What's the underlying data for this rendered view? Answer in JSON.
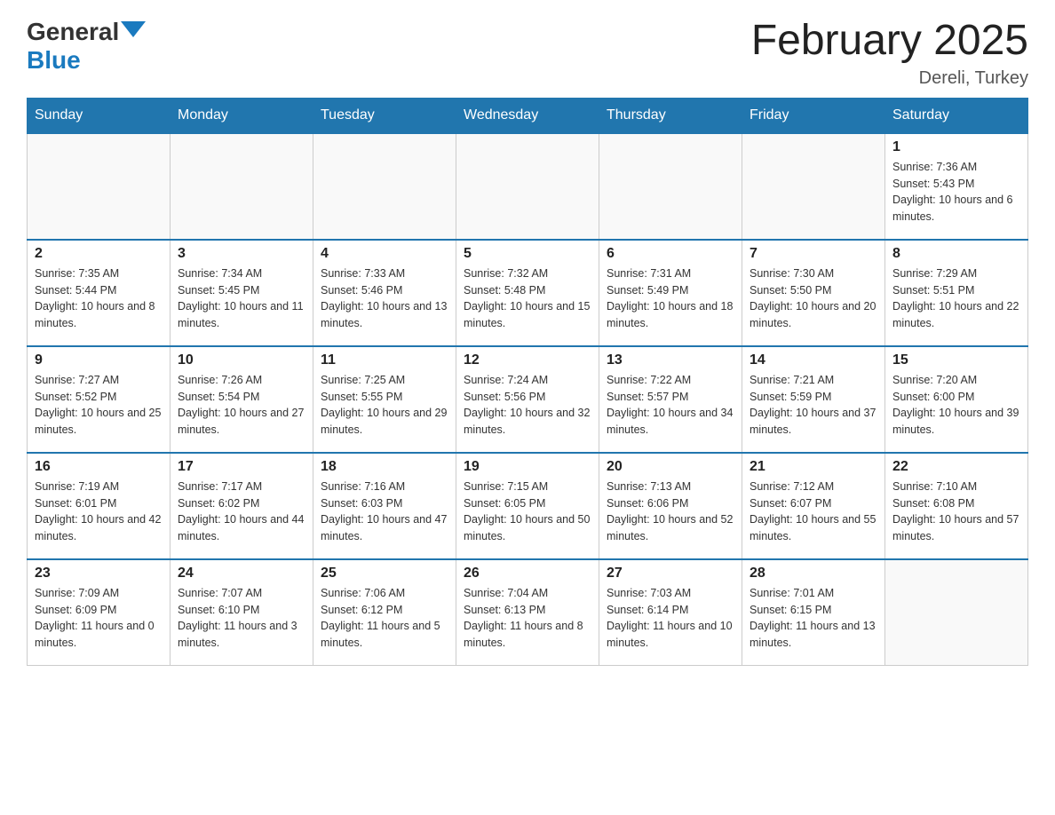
{
  "header": {
    "logo_general": "General",
    "logo_blue": "Blue",
    "month_title": "February 2025",
    "location": "Dereli, Turkey"
  },
  "days_of_week": [
    "Sunday",
    "Monday",
    "Tuesday",
    "Wednesday",
    "Thursday",
    "Friday",
    "Saturday"
  ],
  "weeks": [
    [
      {
        "day": "",
        "info": ""
      },
      {
        "day": "",
        "info": ""
      },
      {
        "day": "",
        "info": ""
      },
      {
        "day": "",
        "info": ""
      },
      {
        "day": "",
        "info": ""
      },
      {
        "day": "",
        "info": ""
      },
      {
        "day": "1",
        "info": "Sunrise: 7:36 AM\nSunset: 5:43 PM\nDaylight: 10 hours and 6 minutes."
      }
    ],
    [
      {
        "day": "2",
        "info": "Sunrise: 7:35 AM\nSunset: 5:44 PM\nDaylight: 10 hours and 8 minutes."
      },
      {
        "day": "3",
        "info": "Sunrise: 7:34 AM\nSunset: 5:45 PM\nDaylight: 10 hours and 11 minutes."
      },
      {
        "day": "4",
        "info": "Sunrise: 7:33 AM\nSunset: 5:46 PM\nDaylight: 10 hours and 13 minutes."
      },
      {
        "day": "5",
        "info": "Sunrise: 7:32 AM\nSunset: 5:48 PM\nDaylight: 10 hours and 15 minutes."
      },
      {
        "day": "6",
        "info": "Sunrise: 7:31 AM\nSunset: 5:49 PM\nDaylight: 10 hours and 18 minutes."
      },
      {
        "day": "7",
        "info": "Sunrise: 7:30 AM\nSunset: 5:50 PM\nDaylight: 10 hours and 20 minutes."
      },
      {
        "day": "8",
        "info": "Sunrise: 7:29 AM\nSunset: 5:51 PM\nDaylight: 10 hours and 22 minutes."
      }
    ],
    [
      {
        "day": "9",
        "info": "Sunrise: 7:27 AM\nSunset: 5:52 PM\nDaylight: 10 hours and 25 minutes."
      },
      {
        "day": "10",
        "info": "Sunrise: 7:26 AM\nSunset: 5:54 PM\nDaylight: 10 hours and 27 minutes."
      },
      {
        "day": "11",
        "info": "Sunrise: 7:25 AM\nSunset: 5:55 PM\nDaylight: 10 hours and 29 minutes."
      },
      {
        "day": "12",
        "info": "Sunrise: 7:24 AM\nSunset: 5:56 PM\nDaylight: 10 hours and 32 minutes."
      },
      {
        "day": "13",
        "info": "Sunrise: 7:22 AM\nSunset: 5:57 PM\nDaylight: 10 hours and 34 minutes."
      },
      {
        "day": "14",
        "info": "Sunrise: 7:21 AM\nSunset: 5:59 PM\nDaylight: 10 hours and 37 minutes."
      },
      {
        "day": "15",
        "info": "Sunrise: 7:20 AM\nSunset: 6:00 PM\nDaylight: 10 hours and 39 minutes."
      }
    ],
    [
      {
        "day": "16",
        "info": "Sunrise: 7:19 AM\nSunset: 6:01 PM\nDaylight: 10 hours and 42 minutes."
      },
      {
        "day": "17",
        "info": "Sunrise: 7:17 AM\nSunset: 6:02 PM\nDaylight: 10 hours and 44 minutes."
      },
      {
        "day": "18",
        "info": "Sunrise: 7:16 AM\nSunset: 6:03 PM\nDaylight: 10 hours and 47 minutes."
      },
      {
        "day": "19",
        "info": "Sunrise: 7:15 AM\nSunset: 6:05 PM\nDaylight: 10 hours and 50 minutes."
      },
      {
        "day": "20",
        "info": "Sunrise: 7:13 AM\nSunset: 6:06 PM\nDaylight: 10 hours and 52 minutes."
      },
      {
        "day": "21",
        "info": "Sunrise: 7:12 AM\nSunset: 6:07 PM\nDaylight: 10 hours and 55 minutes."
      },
      {
        "day": "22",
        "info": "Sunrise: 7:10 AM\nSunset: 6:08 PM\nDaylight: 10 hours and 57 minutes."
      }
    ],
    [
      {
        "day": "23",
        "info": "Sunrise: 7:09 AM\nSunset: 6:09 PM\nDaylight: 11 hours and 0 minutes."
      },
      {
        "day": "24",
        "info": "Sunrise: 7:07 AM\nSunset: 6:10 PM\nDaylight: 11 hours and 3 minutes."
      },
      {
        "day": "25",
        "info": "Sunrise: 7:06 AM\nSunset: 6:12 PM\nDaylight: 11 hours and 5 minutes."
      },
      {
        "day": "26",
        "info": "Sunrise: 7:04 AM\nSunset: 6:13 PM\nDaylight: 11 hours and 8 minutes."
      },
      {
        "day": "27",
        "info": "Sunrise: 7:03 AM\nSunset: 6:14 PM\nDaylight: 11 hours and 10 minutes."
      },
      {
        "day": "28",
        "info": "Sunrise: 7:01 AM\nSunset: 6:15 PM\nDaylight: 11 hours and 13 minutes."
      },
      {
        "day": "",
        "info": ""
      }
    ]
  ]
}
